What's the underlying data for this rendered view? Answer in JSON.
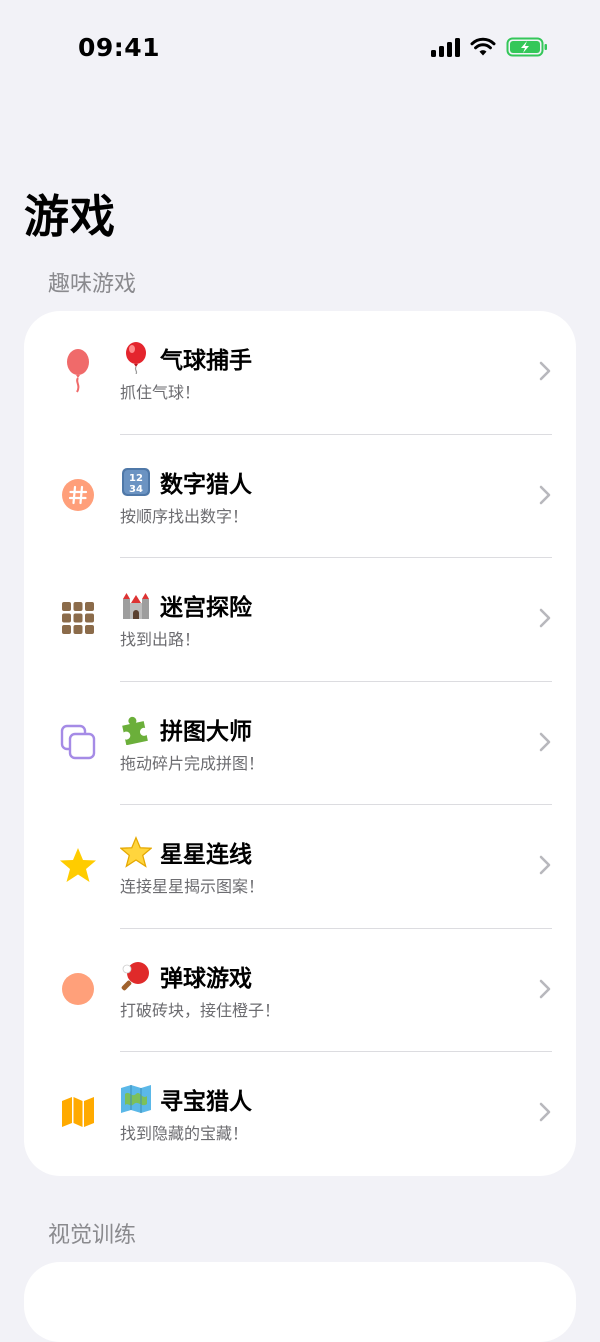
{
  "status_bar": {
    "time": "09:41"
  },
  "page": {
    "title": "游戏"
  },
  "sections": [
    {
      "header": "趣味游戏",
      "items": [
        {
          "emoji": "balloon",
          "title": "气球捕手",
          "subtitle": "抓住气球！",
          "icon": "balloon-icon",
          "color": "#F06A6A"
        },
        {
          "emoji": "input-numbers",
          "title": "数字猎人",
          "subtitle": "按顺序找出数字！",
          "icon": "hash-circle-icon",
          "color": "#FF9F7A"
        },
        {
          "emoji": "castle",
          "title": "迷宫探险",
          "subtitle": "找到出路！",
          "icon": "grid-icon",
          "color": "#8B6B4A"
        },
        {
          "emoji": "puzzle-piece",
          "title": "拼图大师",
          "subtitle": "拖动碎片完成拼图！",
          "icon": "squares-overlap-icon",
          "color": "#A58BE6"
        },
        {
          "emoji": "star",
          "title": "星星连线",
          "subtitle": "连接星星揭示图案！",
          "icon": "star-icon",
          "color": "#FFCC00"
        },
        {
          "emoji": "ping-pong",
          "title": "弹球游戏",
          "subtitle": "打破砖块，接住橙子！",
          "icon": "circle-icon",
          "color": "#FFA07A"
        },
        {
          "emoji": "map",
          "title": "寻宝猎人",
          "subtitle": "找到隐藏的宝藏！",
          "icon": "map-icon",
          "color": "#FFAA00"
        }
      ]
    },
    {
      "header": "视觉训练"
    }
  ]
}
